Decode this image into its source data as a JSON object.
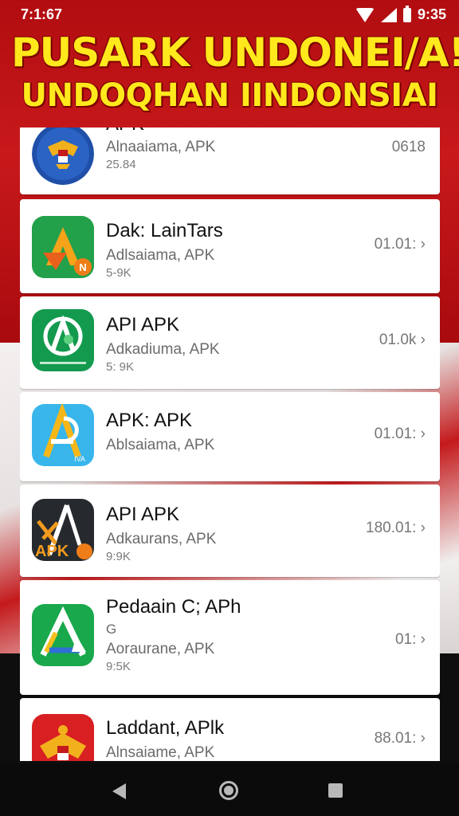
{
  "status_bar": {
    "time": "7:1:67",
    "right_time": "9:35",
    "icons": [
      "wifi-icon",
      "signal-icon",
      "battery-icon"
    ]
  },
  "headline": {
    "line1": "PUSARK UNDONEI/A!",
    "line2": "UNDOQHAN IINDONSIAI"
  },
  "apps": [
    {
      "name": "APK",
      "subtitle": "Alnaaiama, APK",
      "size": "25.84",
      "extra": "",
      "meta": "0618",
      "icon": "garuda-icon"
    },
    {
      "name": "Dak: LainTars",
      "subtitle": "Adlsaiama, APK",
      "size": "5-9K",
      "extra": "",
      "meta": "01.01: ›",
      "icon": "orange-a-icon"
    },
    {
      "name": "API APK",
      "subtitle": "Adkadiuma, APK",
      "size": "5: 9K",
      "extra": "",
      "meta": "01.0k ›",
      "icon": "green-a-icon"
    },
    {
      "name": "APK: APK",
      "subtitle": "Ablsaiama, APK",
      "size": "",
      "extra": "",
      "meta": "01.01: ›",
      "icon": "blue-a-icon"
    },
    {
      "name": "API APK",
      "subtitle": "Adkaurans, APK",
      "size": "9:9K",
      "extra": "",
      "meta": "180.01: ›",
      "icon": "dark-apk-icon"
    },
    {
      "name": "Pedaain C; APh",
      "subtitle": "Aoraurane, APK",
      "size": "9:5K",
      "extra": "G",
      "meta": "01: ›",
      "icon": "green-white-a-icon"
    },
    {
      "name": "Laddant, APlk",
      "subtitle": "Alnsaiame, APK",
      "size": "",
      "extra": "",
      "meta": "88.01: ›",
      "icon": "red-garuda-icon"
    }
  ],
  "nav": {
    "icons": [
      "back-icon",
      "home-icon",
      "recent-apps-icon"
    ]
  },
  "colors": {
    "headline": "#ffe81c",
    "flag_red": "#c8191b",
    "card_bg": "#ffffff"
  }
}
